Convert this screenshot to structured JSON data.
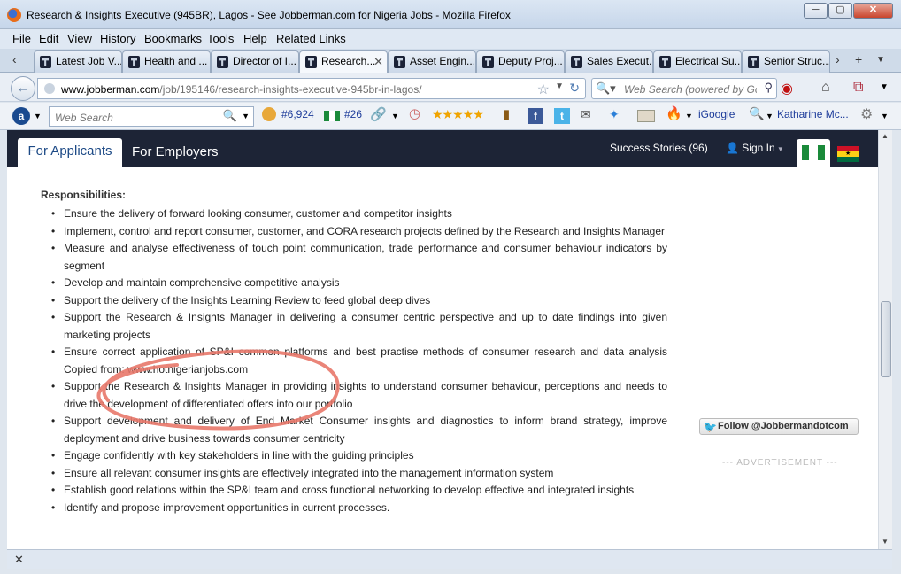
{
  "window": {
    "title": "Research & Insights Executive (945BR), Lagos - See Jobberman.com for Nigeria Jobs - Mozilla Firefox",
    "minimize": "─",
    "maximize": "▢",
    "close": "✕"
  },
  "menu": [
    "File",
    "Edit",
    "View",
    "History",
    "Bookmarks",
    "Tools",
    "Help",
    "Related Links"
  ],
  "tabs": [
    {
      "label": "Latest Job V..."
    },
    {
      "label": "Health and ..."
    },
    {
      "label": "Director of I..."
    },
    {
      "label": "Research..."
    },
    {
      "label": "Asset Engin..."
    },
    {
      "label": "Deputy Proj..."
    },
    {
      "label": "Sales Execut..."
    },
    {
      "label": "Electrical Su..."
    },
    {
      "label": "Senior Struc..."
    }
  ],
  "nav": {
    "url_host": "www.jobberman.com",
    "url_path": "/job/195146/research-insights-executive-945br-in-lagos/",
    "search_placeholder": "Web Search (powered by Goo"
  },
  "toolbar": {
    "web_search": "Web Search",
    "rank1": "#6,924",
    "rank2": "#26",
    "stars": "★★★★★",
    "igoogle": "iGoogle",
    "user": "Katharine Mc..."
  },
  "site": {
    "tab_applicants": "For Applicants",
    "tab_employers": "For Employers",
    "success_stories": "Success Stories (96)",
    "sign_in": "Sign In"
  },
  "content": {
    "heading": "Responsibilities:",
    "items": [
      "Ensure the delivery of forward looking consumer, customer and competitor insights",
      "Implement, control and report consumer, customer, and CORA research projects defined by the Research and Insights Manager",
      "Measure and analyse effectiveness of touch point communication, trade performance and consumer behaviour indicators by segment",
      "Develop and maintain comprehensive competitive analysis",
      "Support the delivery of the Insights Learning Review to feed global deep dives",
      "Support the Research & Insights Manager in delivering a consumer centric perspective and up to date findings into given marketing projects",
      "Ensure correct application of SP&I common platforms and best practise methods of consumer research and data analysis Copied from: www.hotnigerianjobs.com",
      "Support the Research & Insights Manager in providing insights to understand consumer behaviour, perceptions and needs to drive the development of differentiated offers into our portfolio",
      "Support development and delivery of End Market Consumer insights and diagnostics to inform brand strategy, improve deployment and drive business towards consumer centricity",
      "Engage confidently with key stakeholders in line with the guiding principles",
      "Ensure all relevant consumer insights are effectively integrated into the management information system",
      "Establish good relations within the SP&I team and cross functional networking to develop effective and integrated insights",
      "Identify and propose improvement opportunities in current processes."
    ],
    "follow": "Follow @Jobbermandotcom",
    "advertisement": "--- ADVERTISEMENT ---"
  },
  "findbar": {
    "close": "✕"
  },
  "colors": {
    "site_nav_bg": "#1d2436",
    "annotation_circle": "#e8786a",
    "nigeria_green": "#1a8a3a",
    "ghana_red": "#ce1126",
    "ghana_gold": "#fcd116",
    "ghana_green": "#006b3f"
  }
}
